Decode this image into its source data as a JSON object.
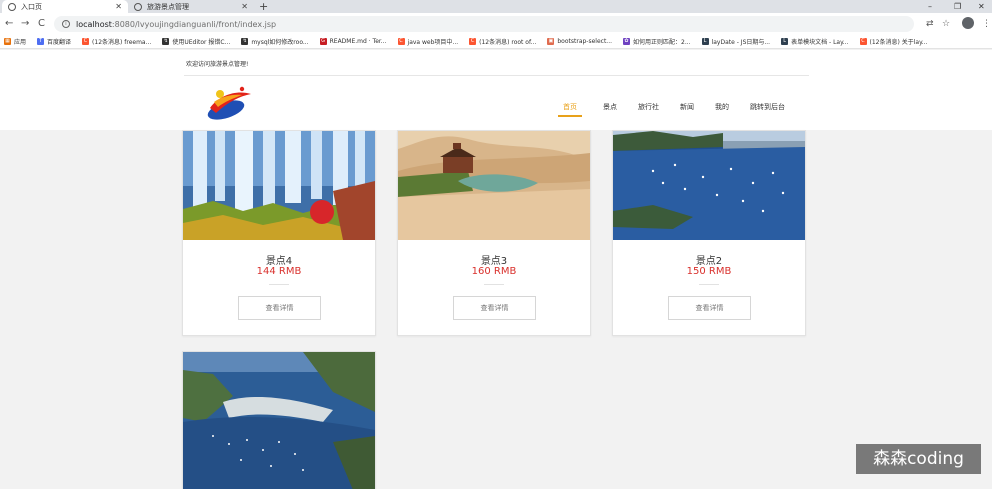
{
  "browser": {
    "tabs": [
      {
        "title": "入口页",
        "active": true
      },
      {
        "title": "旅游景点管理",
        "active": false
      }
    ],
    "new_tab": "+",
    "window_controls": [
      "–",
      "❐",
      "✕"
    ],
    "nav": {
      "back": "←",
      "forward": "→",
      "reload": "C"
    },
    "url_host": "localhost",
    "url_path": ":8080/lvyoujingdianguanli/front/index.jsp",
    "tool_icons": [
      "⇄",
      "☆",
      "⋮"
    ],
    "bookmarks": [
      {
        "label": "应用",
        "color": "#e8710a",
        "icon": "apps-grid-icon",
        "glyph": "▦"
      },
      {
        "label": "百度翻译",
        "color": "#4e6ef2",
        "icon": "baidu-translate-icon",
        "glyph": "T"
      },
      {
        "label": "(12条消息) freema...",
        "color": "#fc5531",
        "icon": "csdn-icon",
        "glyph": "C"
      },
      {
        "label": "使用UEditor 报错C...",
        "color": "#333333",
        "icon": "cnblogs-icon",
        "glyph": "↯"
      },
      {
        "label": "mysql如何修改roo...",
        "color": "#333333",
        "icon": "cnblogs-icon",
        "glyph": "↯"
      },
      {
        "label": "README.md · Ter...",
        "color": "#c71d23",
        "icon": "gitee-icon",
        "glyph": "G"
      },
      {
        "label": "java web项目中...",
        "color": "#fc5531",
        "icon": "csdn-icon",
        "glyph": "C"
      },
      {
        "label": "(12条消息) root of...",
        "color": "#fc5531",
        "icon": "csdn-icon",
        "glyph": "C"
      },
      {
        "label": "bootstrap-select...",
        "color": "#e06c4f",
        "icon": "bootstrap-icon",
        "glyph": "▣"
      },
      {
        "label": "如何用正则匹配：2...",
        "color": "#6f42c1",
        "icon": "badge-icon",
        "glyph": "✿"
      },
      {
        "label": "layDate - JS日期与...",
        "color": "#2f4050",
        "icon": "layui-icon",
        "glyph": "L"
      },
      {
        "label": "表单模块文档 - Lay...",
        "color": "#2f4050",
        "icon": "layui-icon",
        "glyph": "L"
      },
      {
        "label": "(12条消息) 关于lay...",
        "color": "#fc5531",
        "icon": "csdn-icon",
        "glyph": "C"
      }
    ]
  },
  "header": {
    "welcome": "欢迎访问旅游景点管理!",
    "nav": [
      {
        "label": "首页",
        "active": true
      },
      {
        "label": "景点",
        "active": false
      },
      {
        "label": "旅行社",
        "active": false
      },
      {
        "label": "新闻",
        "active": false
      },
      {
        "label": "我的",
        "active": false
      },
      {
        "label": "跳转到后台",
        "active": false
      }
    ]
  },
  "spots": [
    {
      "name": "景点4",
      "price": "144 RMB",
      "button": "查看详情"
    },
    {
      "name": "景点3",
      "price": "160 RMB",
      "button": "查看详情"
    },
    {
      "name": "景点2",
      "price": "150 RMB",
      "button": "查看详情"
    },
    {
      "name": "",
      "price": "",
      "button": ""
    }
  ],
  "watermark": "森森coding"
}
